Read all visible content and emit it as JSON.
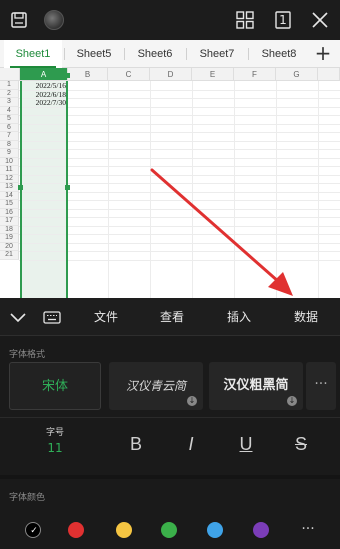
{
  "topbar": {
    "page_indicator": "1"
  },
  "tabs": [
    "Sheet1",
    "Sheet5",
    "Sheet6",
    "Sheet7",
    "Sheet8"
  ],
  "add_tab": "+",
  "sheet": {
    "columns": [
      "A",
      "B",
      "C",
      "D",
      "E",
      "F",
      "G"
    ],
    "rows": [
      "1",
      "2",
      "3",
      "4",
      "5",
      "6",
      "7",
      "8",
      "9",
      "10",
      "11",
      "12",
      "13",
      "14",
      "15",
      "16",
      "17",
      "18",
      "19",
      "20",
      "21"
    ],
    "cells": [
      "2022/5/16",
      "2022/6/18",
      "2022/7/30"
    ],
    "selected_column": "A",
    "selection_color": "#2e9b4f",
    "arrow_color": "#e03131"
  },
  "toolbar": {
    "items": [
      "文件",
      "查看",
      "插入",
      "数据"
    ]
  },
  "font_panel": {
    "font_format_label": "字体格式",
    "fonts": [
      "宋体",
      "汉仪青云简",
      "汉仪粗黑简"
    ],
    "more": "···",
    "size_label": "字号",
    "size_value": "11",
    "styles": [
      "B",
      "I",
      "U",
      "S"
    ],
    "font_color_label": "字体颜色",
    "colors": [
      "#000000",
      "#e03131",
      "#f5c542",
      "#3bb04a",
      "#3fa3e8",
      "#7b3db8"
    ],
    "selected_color_mark": "✓",
    "more_colors": "···",
    "accent_color": "#2fae58"
  }
}
